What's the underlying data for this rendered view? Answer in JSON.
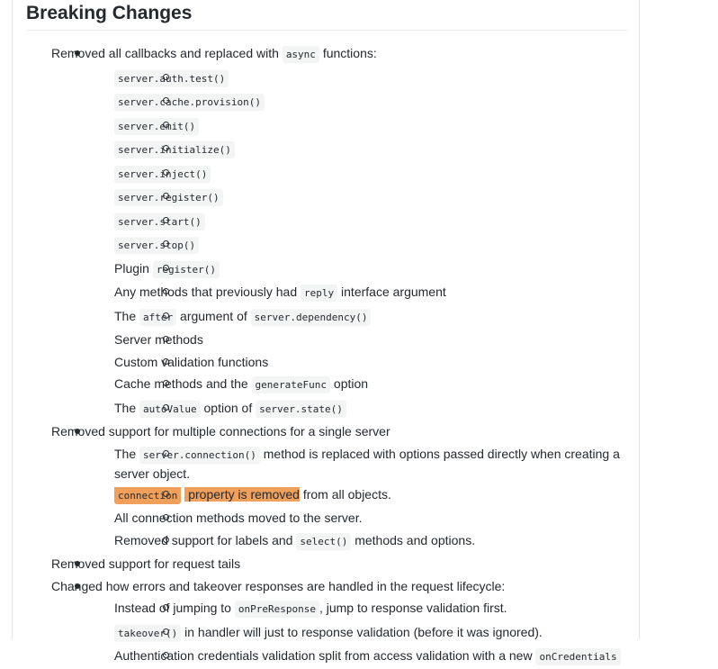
{
  "heading": "Breaking Changes",
  "items": [
    {
      "text_before": "Removed all callbacks and replaced with ",
      "code": "async",
      "text_after": " functions:",
      "children": [
        {
          "code": "server.auth.test()"
        },
        {
          "code": "server.cache.provision()"
        },
        {
          "code": "server.emit()"
        },
        {
          "code": "server.initialize()"
        },
        {
          "code": "server.inject()"
        },
        {
          "code": "server.register()"
        },
        {
          "code": "server.start()"
        },
        {
          "code": "server.stop()"
        },
        {
          "text_before": "Plugin ",
          "code": "register()"
        },
        {
          "text_before": "Any methods that previously had ",
          "code": "reply",
          "text_after": " interface argument"
        },
        {
          "text_before": "The ",
          "code": "after",
          "text_mid": " argument of ",
          "code2": "server.dependency()"
        },
        {
          "text": "Server methods"
        },
        {
          "text": "Custom validation functions"
        },
        {
          "text_before": "Cache methods and the ",
          "code": "generateFunc",
          "text_after": " option"
        },
        {
          "text_before": "The ",
          "code": "autoValue",
          "text_mid": " option of ",
          "code2": "server.state()"
        }
      ]
    },
    {
      "text": "Removed support for multiple connections for a single server",
      "children": [
        {
          "text_before": "The ",
          "code": "server.connection()",
          "text_after": " method is replaced with options passed directly when creating a server object."
        },
        {
          "code": "connection",
          "highlight_text": "property is removed",
          "text_after": " from all objects."
        },
        {
          "text": "All connection methods moved to the server."
        },
        {
          "text_before": "Removed support for labels and ",
          "code": "select()",
          "text_after": " methods and options."
        }
      ]
    },
    {
      "text": "Removed support for request tails"
    },
    {
      "text": "Changed how errors and takeover responses are handled in the request lifecycle:",
      "children": [
        {
          "text_before": "Instead of jumping to ",
          "code": "onPreResponse",
          "text_after": ", jump to response validation first."
        },
        {
          "code": "takeover()",
          "text_after": " in handler will just to response validation (before it was ignored)."
        },
        {
          "text_before": "Authentication credentials validation split from access validation with a new ",
          "code": "onCredentials"
        }
      ]
    }
  ]
}
